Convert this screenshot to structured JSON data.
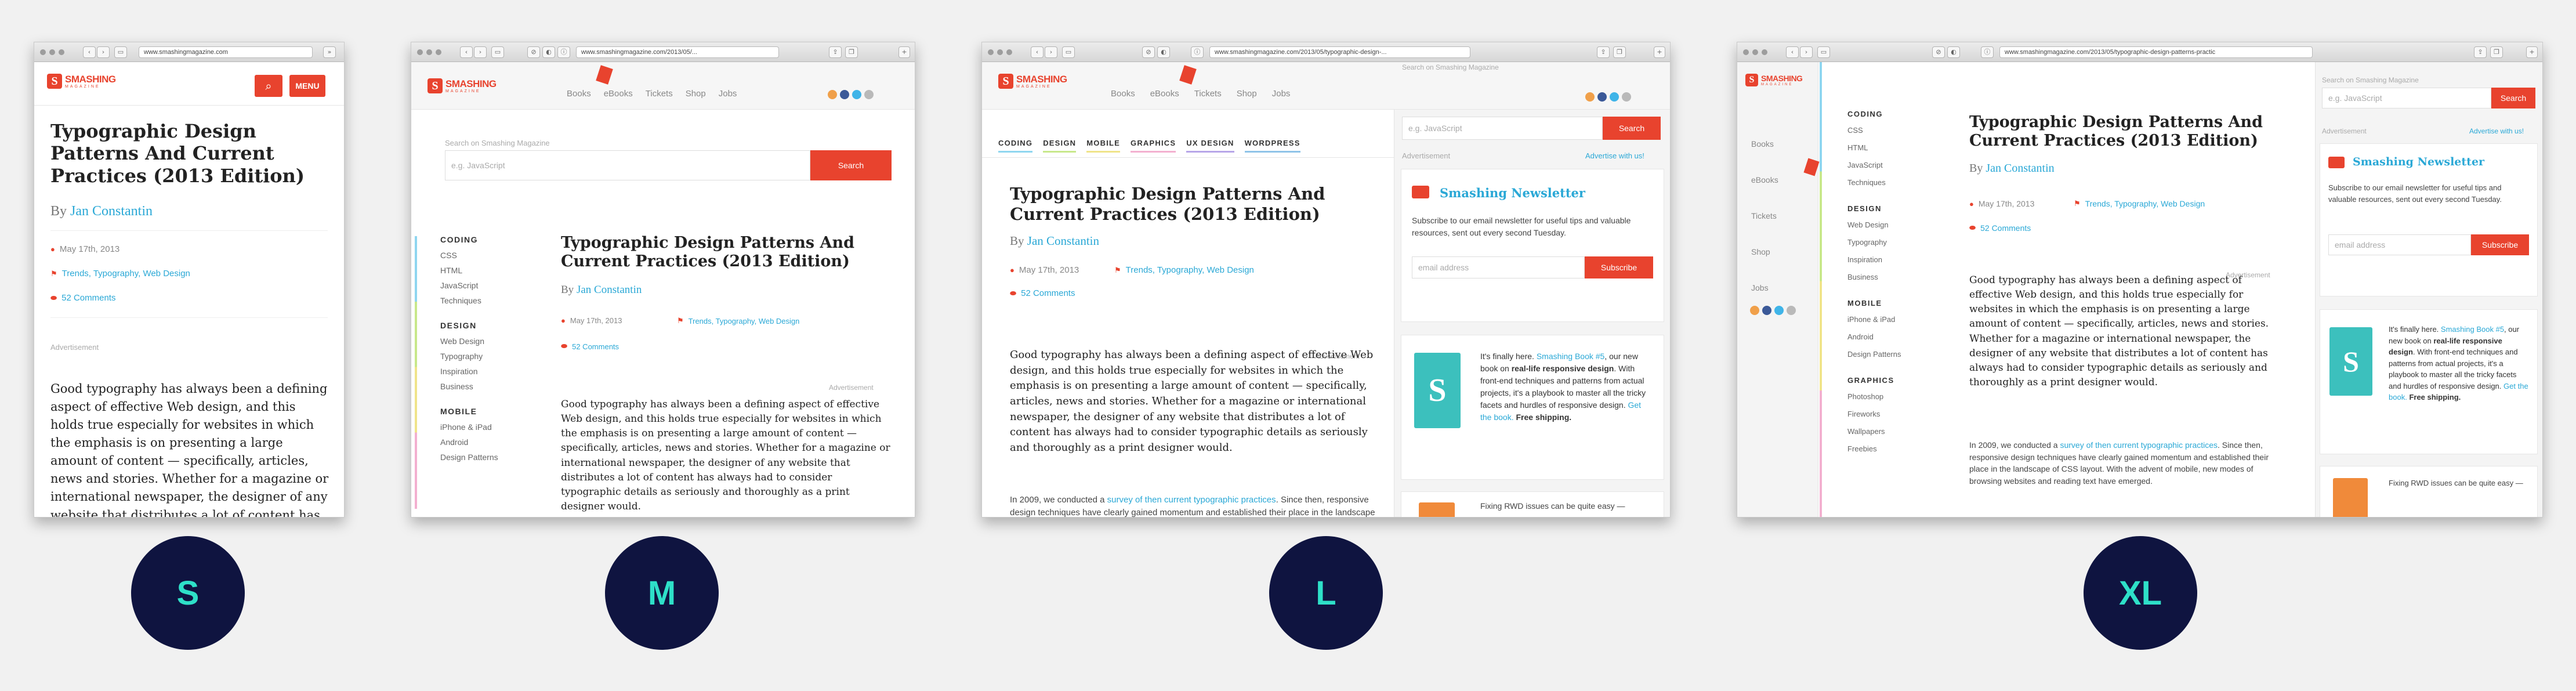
{
  "labels": {
    "s": "S",
    "m": "M",
    "l": "L",
    "xl": "XL"
  },
  "browser": {
    "url_s": "www.smashingmagazine.com",
    "url_m": "www.smashingmagazine.com/2013/05/...",
    "url_l": "www.smashingmagazine.com/2013/05/typographic-design-...",
    "url_xl": "www.smashingmagazine.com/2013/05/typographic-design-patterns-practic"
  },
  "logo": {
    "mark": "S",
    "word": "SMASHING",
    "sub": "MAGAZINE"
  },
  "header": {
    "menu": "MENU",
    "search_icon": "search-icon"
  },
  "topnav": [
    "Books",
    "eBooks",
    "Tickets",
    "Shop",
    "Jobs"
  ],
  "search": {
    "label": "Search on Smashing Magazine",
    "placeholder": "e.g. JavaScript",
    "button": "Search"
  },
  "article": {
    "title": "Typographic Design Patterns And Current Practices (2013 Edition)",
    "by": "By",
    "author": "Jan Constantin",
    "date": "May 17th, 2013",
    "tags": "Trends, Typography, Web Design",
    "comments": "52 Comments",
    "advertisement": "Advertisement",
    "p1": "Good typography has always been a defining aspect of effective Web design, and this holds true especially for websites in which the emphasis is on presenting a large amount of content — specifically, articles, news and stories. Whether for a magazine or international newspaper, the designer of any website that distributes a lot of content has always had to consider typographic details as seriously and thoroughly as a print designer would.",
    "p2_pre": "In 2009, we conducted a",
    "p2_link": "survey of then current typographic practices",
    "p2_post": ". Since then, responsive design techniques have clearly gained momentum and established their place in the landscape of CSS layout. With the advent of mobile, new modes of browsing websites and reading text have emerged."
  },
  "sidenav": {
    "coding": "CODING",
    "coding_items": [
      "CSS",
      "HTML",
      "JavaScript",
      "Techniques"
    ],
    "design": "DESIGN",
    "design_items": [
      "Web Design",
      "Typography",
      "Inspiration",
      "Business"
    ],
    "mobile": "MOBILE",
    "mobile_items": [
      "iPhone & iPad",
      "Android",
      "Design Patterns"
    ],
    "graphics": "GRAPHICS",
    "graphics_items": [
      "Photoshop",
      "Fireworks",
      "Wallpapers",
      "Freebies"
    ]
  },
  "cats": [
    "CODING",
    "DESIGN",
    "MOBILE",
    "GRAPHICS",
    "UX DESIGN",
    "WORDPRESS"
  ],
  "sidebar": {
    "advertisement": "Advertisement",
    "advertise": "Advertise with us!",
    "newsletter_title": "Smashing Newsletter",
    "newsletter_text": "Subscribe to our email newsletter for useful tips and valuable resources, sent out every second Tuesday.",
    "email_placeholder": "email address",
    "subscribe": "Subscribe",
    "book_pre": "It's finally here.",
    "book_link": "Smashing Book #5",
    "book_mid": ", our new book on",
    "book_bold": "real-life responsive design",
    "book_post": ". With front-end techniques and patterns from actual projects, it's a playbook to master all the tricky facets and hurdles of responsive design.",
    "book_get": "Get the book.",
    "book_ship": "Free shipping.",
    "rwd": "Fixing RWD issues can be quite easy —"
  },
  "colors": {
    "accent": "#e8432e",
    "link": "#2aa8d6",
    "label_bg": "#0f1440",
    "label_fg": "#2ee0c8"
  }
}
